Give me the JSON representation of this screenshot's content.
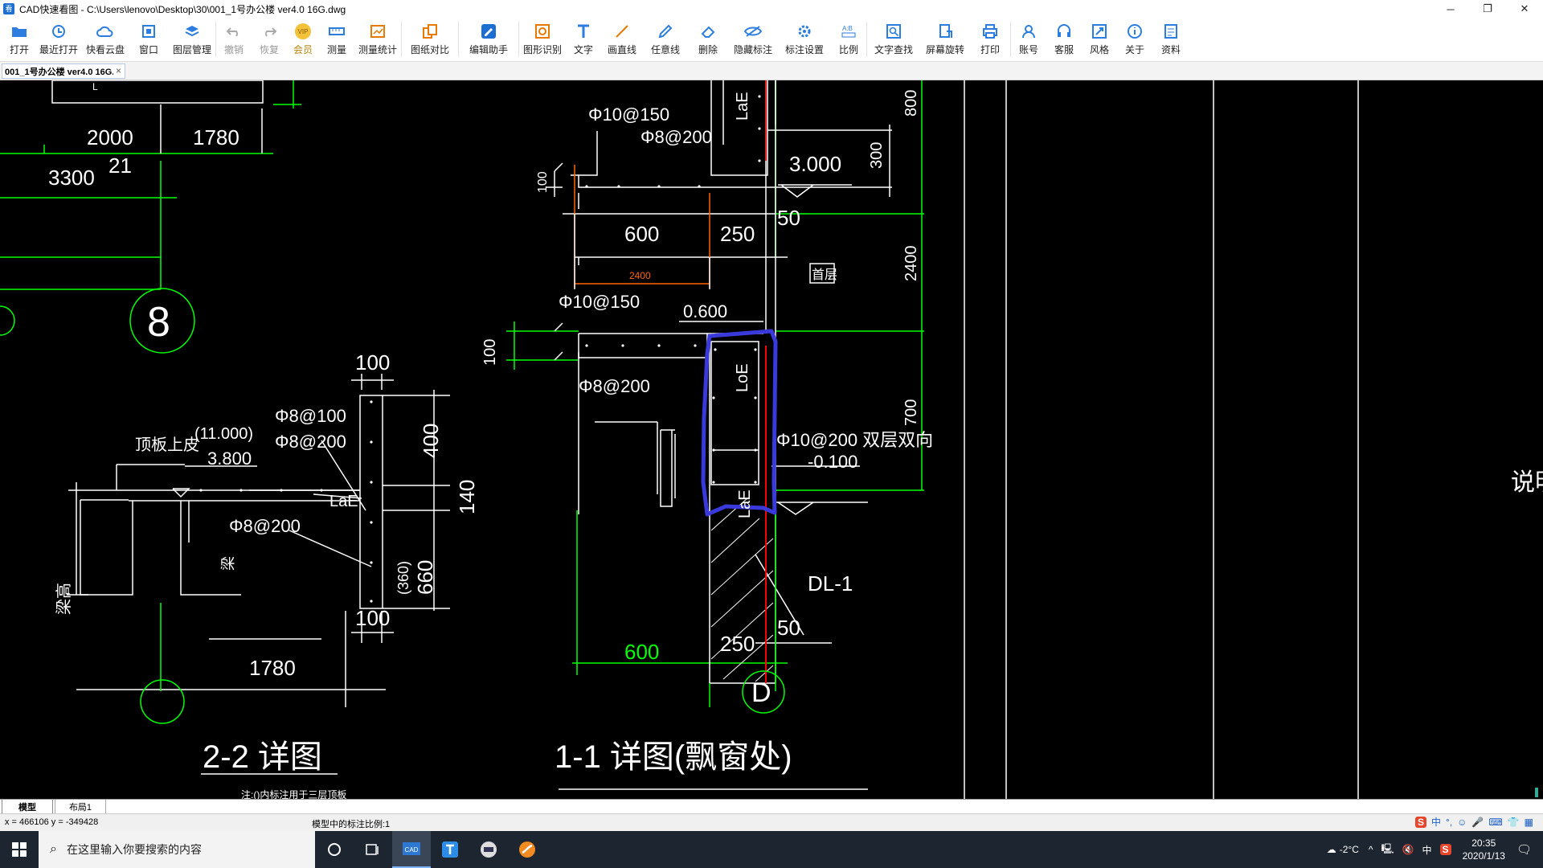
{
  "window": {
    "title": "CAD快速看图 - C:\\Users\\lenovo\\Desktop\\30\\001_1号办公楼 ver4.0 16G.dwg",
    "app_icon_text": "看",
    "minimize": "─",
    "maximize": "❐",
    "close": "✕"
  },
  "toolbar": {
    "items": [
      {
        "label": "打开",
        "icon": "folder-icon"
      },
      {
        "label": "最近打开",
        "icon": "recent-icon"
      },
      {
        "label": "快看云盘",
        "icon": "cloud-icon"
      },
      {
        "label": "窗口",
        "icon": "window-icon"
      },
      {
        "label": "图层管理",
        "icon": "layers-icon"
      },
      {
        "label": "撤销",
        "icon": "undo-icon"
      },
      {
        "label": "恢复",
        "icon": "redo-icon"
      },
      {
        "label": "会员",
        "icon": "vip-icon"
      },
      {
        "label": "测量",
        "icon": "measure-icon"
      },
      {
        "label": "测量统计",
        "icon": "measure-stats-icon"
      },
      {
        "label": "图纸对比",
        "icon": "compare-icon"
      },
      {
        "label": "编辑助手",
        "icon": "edit-assistant-icon"
      },
      {
        "label": "图形识别",
        "icon": "shape-recognition-icon"
      },
      {
        "label": "文字",
        "icon": "text-icon"
      },
      {
        "label": "画直线",
        "icon": "line-icon"
      },
      {
        "label": "任意线",
        "icon": "freehand-icon"
      },
      {
        "label": "删除",
        "icon": "eraser-icon"
      },
      {
        "label": "隐藏标注",
        "icon": "hide-annotation-icon"
      },
      {
        "label": "标注设置",
        "icon": "annotation-settings-icon"
      },
      {
        "label": "比例",
        "icon": "scale-icon"
      },
      {
        "label": "文字查找",
        "icon": "text-search-icon"
      },
      {
        "label": "屏幕旋转",
        "icon": "rotate-icon"
      },
      {
        "label": "打印",
        "icon": "print-icon"
      },
      {
        "label": "账号",
        "icon": "account-icon"
      },
      {
        "label": "客服",
        "icon": "headset-icon"
      },
      {
        "label": "风格",
        "icon": "style-icon"
      },
      {
        "label": "关于",
        "icon": "info-icon"
      },
      {
        "label": "资料",
        "icon": "docs-icon"
      }
    ],
    "vip_text": "VIP"
  },
  "tab": {
    "label": "001_1号办公楼 ver4.0 16G.dwg",
    "close": "×"
  },
  "drawing": {
    "left": {
      "dims_top": [
        "2000",
        "1780",
        "3300",
        "21"
      ],
      "axis_8": "8",
      "dim_100_top": "100",
      "rebar_1": "Φ8@100",
      "rebar_2": "Φ8@200",
      "elev_label": "(11.000)",
      "elev_value": "3.800",
      "roof_label": "顶板上皮",
      "laE": "LaE",
      "rebar_3": "Φ8@200",
      "beam_height": "梁高",
      "beam": "梁",
      "dim_400": "400",
      "dim_140": "140",
      "dim_360": "(360)",
      "dim_660": "660",
      "dim_100_bottom": "100",
      "dim_1780": "1780",
      "title": "2-2 详图",
      "note": "注:()内标注用于三层顶板"
    },
    "right": {
      "rebar_top_1": "Φ10@150",
      "rebar_top_2": "Φ8@200",
      "laE_top": "LaE",
      "dim_100_a": "100",
      "elev_3000": "3.000",
      "dim_300": "300",
      "dim_800": "800",
      "dim_600_top": "600",
      "dim_250_top": "250",
      "dim_50_top": "50",
      "red_dim": "2400",
      "floor_tag": "首层",
      "dim_2400": "2400",
      "rebar_mid_1": "Φ10@150",
      "elev_0600": "0.600",
      "dim_100_b": "100",
      "rebar_mid_2": "Φ8@200",
      "laE_mid": "LoE",
      "rebar_wall": "Φ10@200 双层双向",
      "elev_neg": "-0.100",
      "dim_700": "700",
      "laE_bottom": "LaE",
      "beam_tag": "DL-1",
      "dim_600_bottom": "600",
      "dim_250_bottom": "250",
      "dim_50_bottom": "50",
      "axis_D": "D",
      "title": "1-1 详图(飘窗处)"
    },
    "edge_text": "说明"
  },
  "layout_tabs": {
    "model": "模型",
    "layout1": "布局1"
  },
  "status": {
    "coords": "x = 466106  y = -349428",
    "scale": "模型中的标注比例:1"
  },
  "taskbar": {
    "search_placeholder": "在这里输入你要搜索的内容",
    "weather": "-2°C",
    "ime_lang": "中",
    "time": "20:35",
    "date": "2020/1/13"
  }
}
